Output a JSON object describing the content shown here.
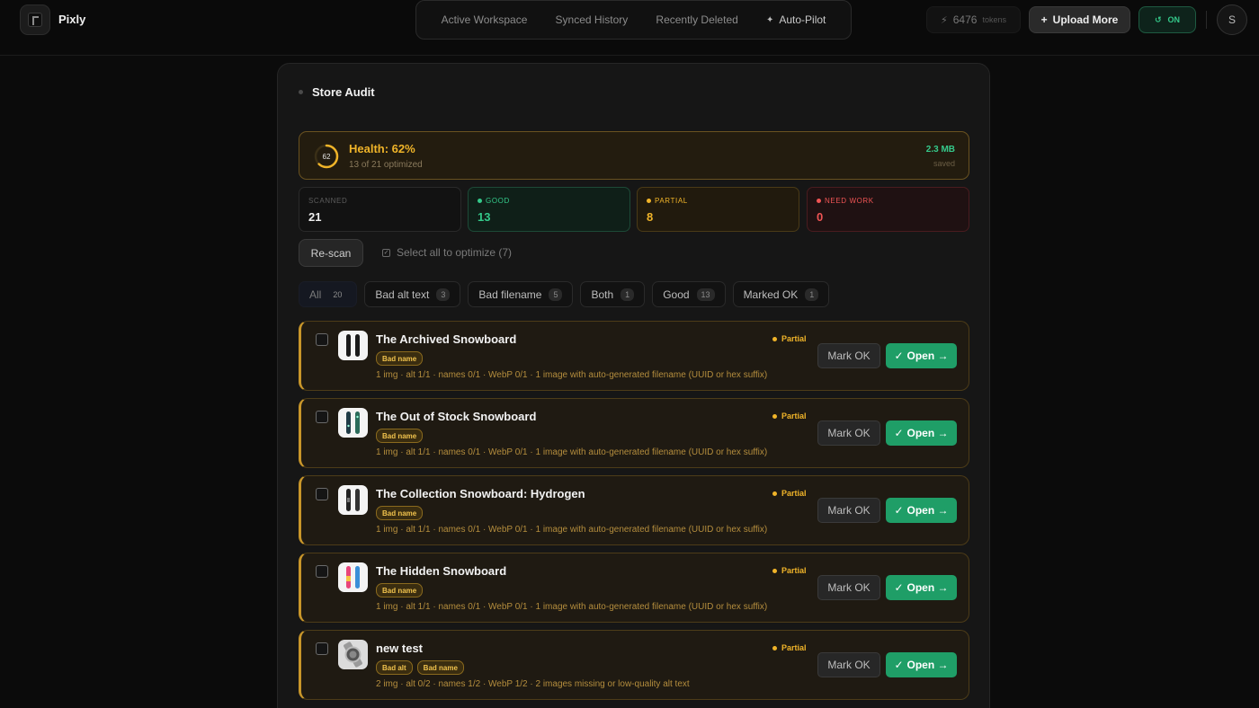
{
  "app": {
    "name": "Pixly"
  },
  "nav": {
    "items": [
      {
        "label": "Active Workspace"
      },
      {
        "label": "Synced History"
      },
      {
        "label": "Recently Deleted"
      },
      {
        "label": "Auto-Pilot"
      }
    ]
  },
  "header": {
    "tokens_value": "6476",
    "tokens_label": "tokens",
    "upload_label": "Upload More",
    "toggle_label": "ON",
    "avatar_initial": "S"
  },
  "panel": {
    "title": "Store Audit"
  },
  "health": {
    "score": 62,
    "score_label": "62",
    "title": "Health: 62%",
    "subtitle": "13 of 21 optimized",
    "saved_value": "2.3 MB",
    "saved_label": "saved"
  },
  "stats": [
    {
      "label": "SCANNED",
      "value": "21"
    },
    {
      "label": "GOOD",
      "value": "13"
    },
    {
      "label": "PARTIAL",
      "value": "8"
    },
    {
      "label": "NEED WORK",
      "value": "0"
    }
  ],
  "actions": {
    "rescan_label": "Re-scan",
    "select_all_label": "Select all to optimize (7)"
  },
  "filters": [
    {
      "label": "All",
      "count": "20"
    },
    {
      "label": "Bad alt text",
      "count": "3"
    },
    {
      "label": "Bad filename",
      "count": "5"
    },
    {
      "label": "Both",
      "count": "1"
    },
    {
      "label": "Good",
      "count": "13"
    },
    {
      "label": "Marked OK",
      "count": "1"
    }
  ],
  "row_actions": {
    "mark_ok": "Mark OK",
    "open": "Open →"
  },
  "products": [
    {
      "name": "The Archived Snowboard",
      "status": "Partial",
      "tags": [
        "Bad name"
      ],
      "meta": "1 img · alt 1/1 · names 0/1 · WebP 0/1 · 1 image with auto-generated filename (UUID or hex suffix)"
    },
    {
      "name": "The Out of Stock Snowboard",
      "status": "Partial",
      "tags": [
        "Bad name"
      ],
      "meta": "1 img · alt 1/1 · names 0/1 · WebP 0/1 · 1 image with auto-generated filename (UUID or hex suffix)"
    },
    {
      "name": "The Collection Snowboard: Hydrogen",
      "status": "Partial",
      "tags": [
        "Bad name"
      ],
      "meta": "1 img · alt 1/1 · names 0/1 · WebP 0/1 · 1 image with auto-generated filename (UUID or hex suffix)"
    },
    {
      "name": "The Hidden Snowboard",
      "status": "Partial",
      "tags": [
        "Bad name"
      ],
      "meta": "1 img · alt 1/1 · names 0/1 · WebP 0/1 · 1 image with auto-generated filename (UUID or hex suffix)"
    },
    {
      "name": "new test",
      "status": "Partial",
      "tags": [
        "Bad alt",
        "Bad name"
      ],
      "meta": "2 img · alt 0/2 · names 1/2 · WebP 1/2 · 2 images missing or low-quality alt text"
    }
  ]
}
